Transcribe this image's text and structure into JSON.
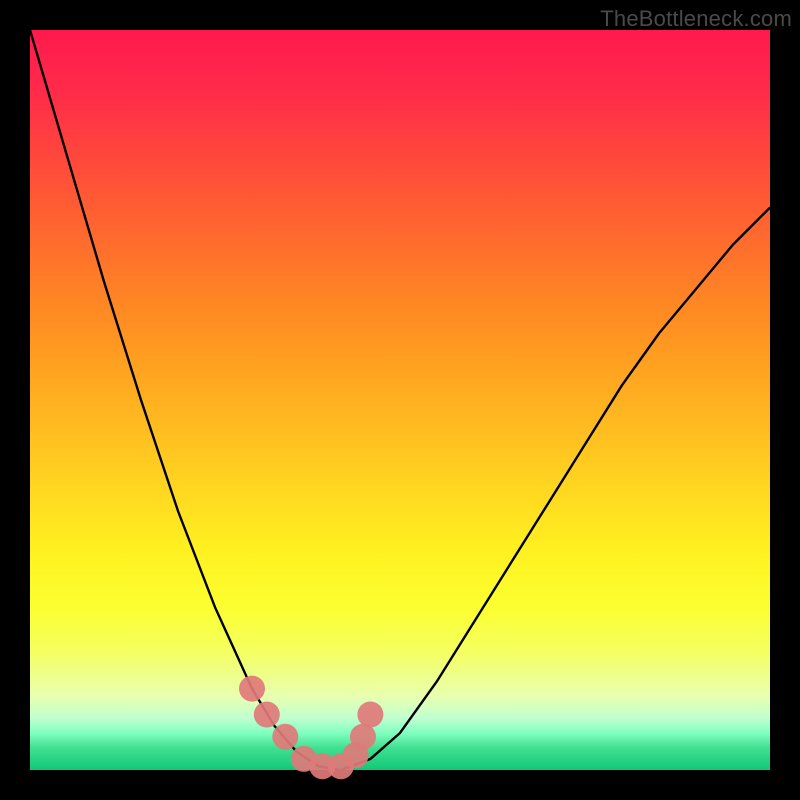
{
  "watermark": "TheBottleneck.com",
  "chart_data": {
    "type": "line",
    "title": "",
    "xlabel": "",
    "ylabel": "",
    "xlim": [
      0,
      1
    ],
    "ylim": [
      0,
      1
    ],
    "series": [
      {
        "name": "bottleneck-curve",
        "x": [
          0.0,
          0.05,
          0.1,
          0.15,
          0.2,
          0.25,
          0.3,
          0.33,
          0.36,
          0.39,
          0.42,
          0.46,
          0.5,
          0.55,
          0.6,
          0.65,
          0.7,
          0.75,
          0.8,
          0.85,
          0.9,
          0.95,
          1.0
        ],
        "y": [
          1.0,
          0.83,
          0.66,
          0.5,
          0.35,
          0.22,
          0.11,
          0.06,
          0.025,
          0.005,
          0.0,
          0.015,
          0.05,
          0.12,
          0.2,
          0.28,
          0.36,
          0.44,
          0.52,
          0.59,
          0.65,
          0.71,
          0.76
        ]
      }
    ],
    "markers": {
      "name": "bottleneck-markers",
      "color": "#e07a7a",
      "x": [
        0.3,
        0.32,
        0.345,
        0.37,
        0.395,
        0.42,
        0.44,
        0.45,
        0.46
      ],
      "y": [
        0.11,
        0.075,
        0.045,
        0.015,
        0.005,
        0.005,
        0.02,
        0.045,
        0.075
      ]
    }
  }
}
